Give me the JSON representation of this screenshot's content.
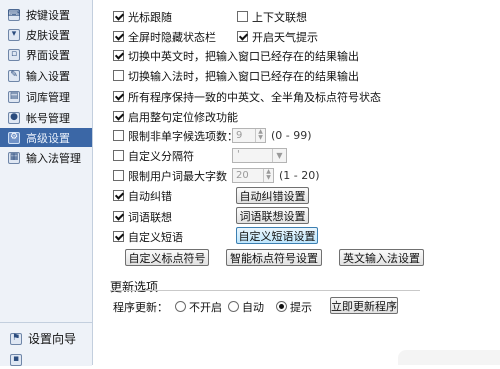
{
  "sidebar": {
    "items": [
      {
        "label": "按键设置",
        "icon": "keyboard-icon"
      },
      {
        "label": "皮肤设置",
        "icon": "shirt-icon"
      },
      {
        "label": "界面设置",
        "icon": "window-icon"
      },
      {
        "label": "输入设置",
        "icon": "input-icon"
      },
      {
        "label": "词库管理",
        "icon": "book-icon"
      },
      {
        "label": "帐号管理",
        "icon": "user-icon"
      },
      {
        "label": "高级设置",
        "icon": "gear-icon",
        "active": true
      },
      {
        "label": "输入法管理",
        "icon": "ime-icon"
      }
    ],
    "bottom_items": [
      {
        "label": "设置向导",
        "icon": "wizard-icon"
      },
      {
        "label": "",
        "icon": "misc-icon"
      }
    ]
  },
  "options": {
    "cursor_follow": {
      "label": "光标跟随",
      "checked": true
    },
    "context_assoc": {
      "label": "上下文联想",
      "checked": false
    },
    "fullscreen_hide": {
      "label": "全屏时隐藏状态栏",
      "checked": true
    },
    "weather": {
      "label": "开启天气提示",
      "checked": true
    },
    "switch_cn_en": {
      "label": "切换中英文时，把输入窗口已经存在的结果输出",
      "checked": true
    },
    "switch_ime": {
      "label": "切换输入法时，把输入窗口已经存在的结果输出",
      "checked": false
    },
    "consistent_state": {
      "label": "所有程序保持一致的中英文、全半角及标点符号状态",
      "checked": true
    },
    "sentence_locate": {
      "label": "启用整句定位修改功能",
      "checked": true
    },
    "limit_candidates": {
      "label": "限制非单字候选项数：",
      "checked": false,
      "value": "9",
      "range": "(0 - 99)"
    },
    "custom_separator": {
      "label": "自定义分隔符",
      "checked": false,
      "value": "'"
    },
    "limit_user_words": {
      "label": "限制用户词最大字数",
      "checked": false,
      "value": "20",
      "range": "(1 - 20)"
    },
    "auto_correct": {
      "label": "自动纠错",
      "checked": true
    },
    "word_assoc": {
      "label": "词语联想",
      "checked": true
    },
    "custom_phrase": {
      "label": "自定义短语",
      "checked": true
    }
  },
  "buttons": {
    "auto_correct_settings": "自动纠错设置",
    "word_assoc_settings": "词语联想设置",
    "custom_phrase_settings": "自定义短语设置",
    "custom_punct": "自定义标点符号",
    "smart_punct_settings": "智能标点符号设置",
    "en_ime_settings": "英文输入法设置"
  },
  "update": {
    "section_title": "更新选项",
    "label": "程序更新：",
    "options": [
      {
        "label": "不开启",
        "selected": false
      },
      {
        "label": "自动",
        "selected": false
      },
      {
        "label": "提示",
        "selected": true
      }
    ],
    "update_now_button": "立即更新程序"
  },
  "colors": {
    "sidebar_bg": "#eef2f8",
    "active_item_bg": "#3b67a6",
    "highlight_button": "#bee6fd"
  }
}
